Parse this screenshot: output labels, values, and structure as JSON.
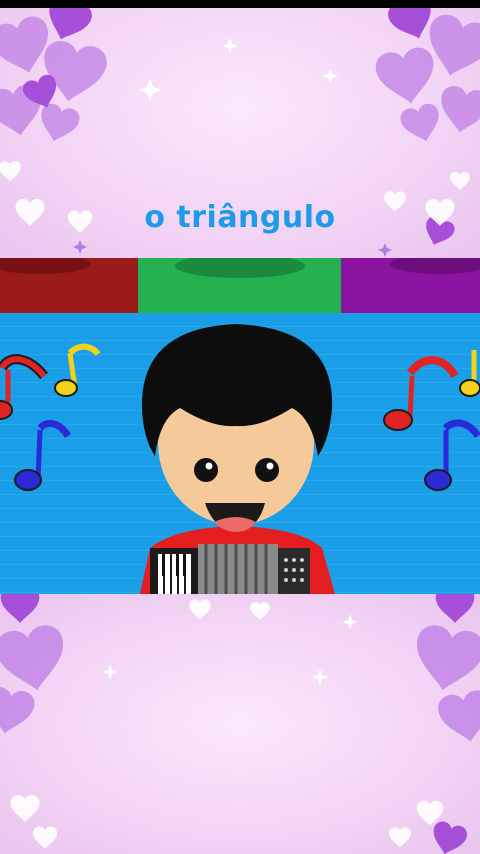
{
  "caption": {
    "text": "o triângulo"
  },
  "scene": {
    "character": "boy-with-accordion",
    "strip_colors": [
      "#9b1a1a",
      "#23b24f",
      "#8a13a0"
    ],
    "background_color": "#1a9ee8",
    "note_colors": [
      "#e02424",
      "#f2d21b",
      "#2a2ad6"
    ]
  },
  "theme": {
    "accent": "#1e9be8",
    "hearts": "#b768e0",
    "panel": "#f3d6f5"
  }
}
